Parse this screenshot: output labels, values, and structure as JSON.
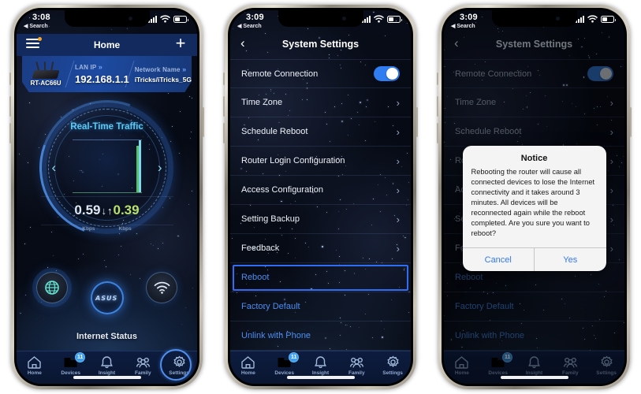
{
  "phones": [
    {
      "id": "home",
      "status": {
        "time": "3:08",
        "back_label": "Search"
      },
      "header": {
        "title": "Home",
        "menu_icon": "hamburger-menu-icon",
        "add_icon": "plus-icon"
      },
      "router_card": {
        "model": "RT-AC66U",
        "lan_ip_label": "LAN IP",
        "lan_ip_value": "192.168.1.1",
        "network_name_label": "Network Name",
        "network_name_value": "iTricks/iTricks_5G",
        "chevron": "»"
      },
      "gauge": {
        "title": "Real-Time Traffic",
        "download_value": "0.59",
        "upload_value": "0.39",
        "download_unit": "Kbps",
        "upload_unit": "Kbps",
        "prev_arrow": "‹",
        "next_arrow": "›",
        "down_arrow": "↓",
        "up_arrow": "↑"
      },
      "quick_buttons": [
        {
          "name": "globe-button",
          "label": "globe-icon"
        },
        {
          "name": "asus-button",
          "label": "ASUS"
        },
        {
          "name": "wifi-button",
          "label": "wifi-icon"
        }
      ],
      "internet_status_label": "Internet Status",
      "highlight_target": "settings"
    },
    {
      "id": "system-settings",
      "status": {
        "time": "3:09",
        "back_label": "Search"
      },
      "header": {
        "title": "System Settings",
        "back_icon": "chevron-left-icon"
      },
      "selected_row_index": 7
    },
    {
      "id": "system-settings-notice",
      "status": {
        "time": "3:09",
        "back_label": "Search"
      },
      "header": {
        "title": "System Settings",
        "back_icon": "chevron-left-icon"
      },
      "dialog": {
        "title": "Notice",
        "body": "Rebooting the router will cause all connected devices to lose the Internet connectivity and it takes around 3 minutes. All devices will be reconnected again while the reboot completed. Are you sure you want to reboot?",
        "cancel_label": "Cancel",
        "confirm_label": "Yes"
      }
    }
  ],
  "settings_rows": [
    {
      "label": "Remote Connection",
      "control": "toggle",
      "toggle_on": true,
      "blue": false
    },
    {
      "label": "Time Zone",
      "control": "chevron",
      "blue": false
    },
    {
      "label": "Schedule Reboot",
      "control": "chevron",
      "blue": false
    },
    {
      "label": "Router Login Configuration",
      "control": "chevron",
      "blue": false
    },
    {
      "label": "Access Configuration",
      "control": "chevron",
      "blue": false
    },
    {
      "label": "Setting Backup",
      "control": "chevron",
      "blue": false
    },
    {
      "label": "Feedback",
      "control": "chevron",
      "blue": false
    },
    {
      "label": "Reboot",
      "control": "none",
      "blue": true
    },
    {
      "label": "Factory Default",
      "control": "none",
      "blue": true
    },
    {
      "label": "Unlink with Phone",
      "control": "none",
      "blue": true
    }
  ],
  "tabbar": [
    {
      "label": "Home",
      "icon": "home-icon",
      "badge": ""
    },
    {
      "label": "Devices",
      "icon": "devices-icon",
      "badge": "11"
    },
    {
      "label": "Insight",
      "icon": "bell-icon",
      "badge": ""
    },
    {
      "label": "Family",
      "icon": "family-icon",
      "badge": ""
    },
    {
      "label": "Settings",
      "icon": "gear-icon",
      "badge": ""
    }
  ],
  "chevron_right": "›",
  "chevron_left": "‹",
  "colors": {
    "accent_blue": "#2f6df5",
    "link_blue": "#4c8df0",
    "toggle_on": "#2f7df0",
    "badge_blue": "#3ea0f0",
    "card_blue": "#1d4aa0",
    "gauge_cyan": "#5fc8ef",
    "upload_green": "#b9e06a"
  }
}
